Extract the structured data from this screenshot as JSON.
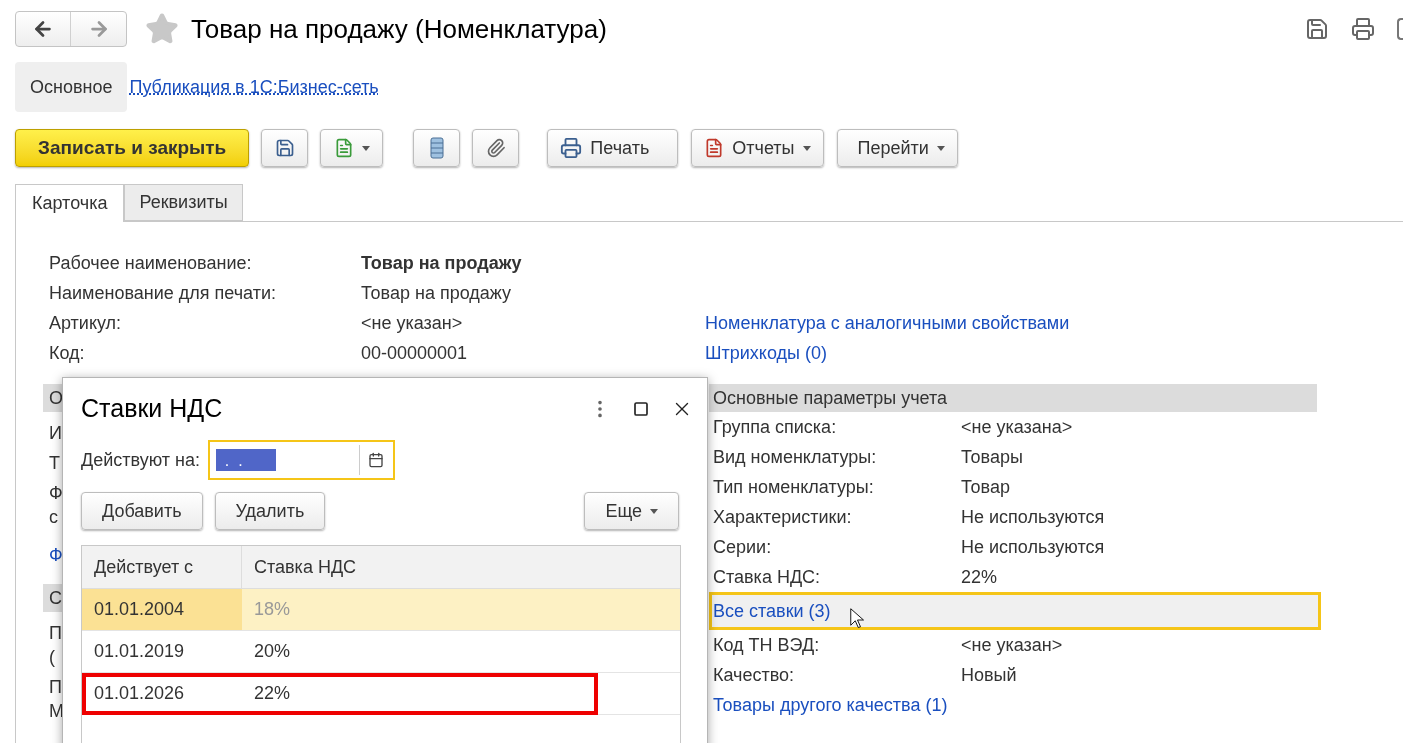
{
  "title": "Товар на продажу (Номенклатура)",
  "sections": [
    {
      "label": "Основное",
      "selected": true
    },
    {
      "label": "Публикация в 1С:Бизнес-сеть",
      "selected": false
    }
  ],
  "toolbar": {
    "primary": "Записать и закрыть",
    "buttons": [
      {
        "label": "Печать",
        "dropdown": false
      },
      {
        "label": "Отчеты",
        "dropdown": true
      },
      {
        "label": "Перейти",
        "dropdown": true
      }
    ]
  },
  "tabs": [
    {
      "label": "Карточка",
      "selected": true
    },
    {
      "label": "Реквизиты",
      "selected": false
    }
  ],
  "fields": [
    {
      "label": "Рабочее наименование:",
      "value": "Товар на продажу",
      "bold": true
    },
    {
      "label": "Наименование для печати:",
      "value": "Товар на продажу",
      "bold": false
    },
    {
      "label": "Артикул:",
      "value": "<не указан>",
      "bold": false,
      "link": "Номенклатура с аналогичными свойствами"
    },
    {
      "label": "Код:",
      "value": "00-00000001",
      "bold": false,
      "link": "Штрихкоды (0)"
    }
  ],
  "left_fragments": [
    {
      "kind": "header",
      "text": "О"
    },
    {
      "kind": "text",
      "text": "И"
    },
    {
      "kind": "text",
      "text": "Т"
    },
    {
      "kind": "text",
      "text": "Ф"
    },
    {
      "kind": "wrap",
      "text": "с"
    },
    {
      "kind": "link",
      "text": "Ф"
    },
    {
      "kind": "header",
      "text": "С"
    },
    {
      "kind": "text",
      "text": "П"
    },
    {
      "kind": "wrap",
      "text": "("
    },
    {
      "kind": "text",
      "text": "П"
    },
    {
      "kind": "wrap",
      "text": "М"
    }
  ],
  "accounting": {
    "title": "Основные параметры учета",
    "rows": [
      {
        "kind": "field",
        "label": "Группа списка:",
        "value": "<не указана>"
      },
      {
        "kind": "field",
        "label": "Вид номенклатуры:",
        "value": "Товары"
      },
      {
        "kind": "field",
        "label": "Тип номенклатуры:",
        "value": "Товар"
      },
      {
        "kind": "field",
        "label": "Характеристики:",
        "value": "Не используются"
      },
      {
        "kind": "field",
        "label": "Серии:",
        "value": "Не используются"
      },
      {
        "kind": "field",
        "label": "Ставка НДС:",
        "value": "22%"
      },
      {
        "kind": "link",
        "label": "Все ставки (3)",
        "focused": true
      },
      {
        "kind": "field",
        "label": "Код ТН ВЭД:",
        "value": "<не указан>"
      },
      {
        "kind": "field",
        "label": "Качество:",
        "value": "Новый"
      },
      {
        "kind": "link",
        "label": "Товары другого качества (1)",
        "focused": false
      }
    ]
  },
  "dialog": {
    "title": "Ставки НДС",
    "date_label": "Действуют на:",
    "date_value": "  .  .  ",
    "buttons": [
      "Добавить",
      "Удалить"
    ],
    "more": "Еще",
    "columns": [
      "Действует с",
      "Ставка НДС"
    ],
    "rows": [
      {
        "date": "01.01.2004",
        "rate": "18%",
        "selected": true,
        "marked": false
      },
      {
        "date": "01.01.2019",
        "rate": "20%",
        "selected": false,
        "marked": false
      },
      {
        "date": "01.01.2026",
        "rate": "22%",
        "selected": false,
        "marked": true
      }
    ]
  }
}
